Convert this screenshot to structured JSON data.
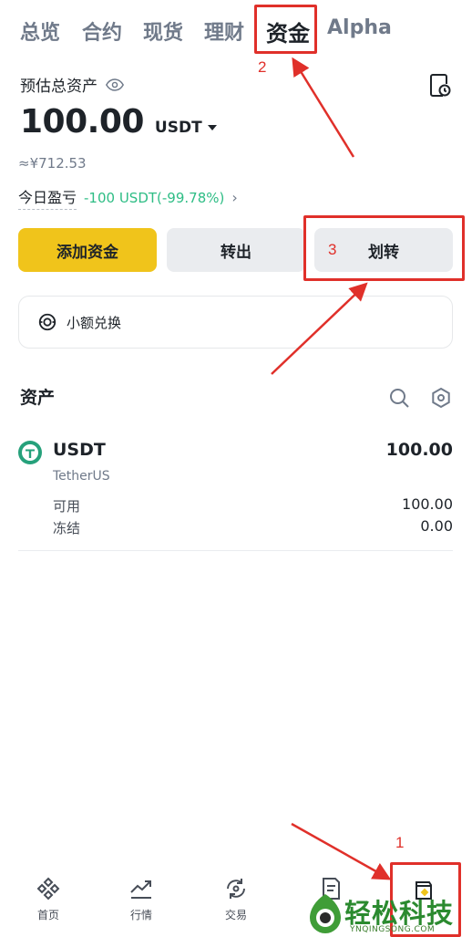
{
  "tabs": [
    {
      "label": "总览"
    },
    {
      "label": "合约"
    },
    {
      "label": "现货"
    },
    {
      "label": "理财"
    },
    {
      "label": "资金",
      "active": true
    },
    {
      "label": "Alpha"
    }
  ],
  "overview": {
    "title": "预估总资产",
    "balance": "100.00",
    "currency": "USDT",
    "approx": "≈¥712.53",
    "pnl_label": "今日盈亏",
    "pnl_value": "-100 USDT(-99.78%)"
  },
  "actions": {
    "add_funds": "添加资金",
    "transfer_out": "转出",
    "transfer": "划转"
  },
  "small_convert": {
    "label": "小额兑换"
  },
  "assets": {
    "header": "资产",
    "items": [
      {
        "symbol": "USDT",
        "name": "TetherUS",
        "total": "100.00",
        "available_label": "可用",
        "available": "100.00",
        "frozen_label": "冻结",
        "frozen": "0.00"
      }
    ]
  },
  "bottom_nav": [
    {
      "label": "首页",
      "icon": "binance-logo-icon"
    },
    {
      "label": "行情",
      "icon": "trend-chart-icon"
    },
    {
      "label": "交易",
      "icon": "exchange-icon"
    },
    {
      "label": "",
      "icon": "document-icon"
    },
    {
      "label": "",
      "icon": "wallet-icon"
    }
  ],
  "annotations": {
    "n1": "1",
    "n2": "2",
    "n3": "3"
  },
  "watermark": {
    "title": "轻松科技",
    "sub": "YNQINGSONG.COM"
  },
  "colors": {
    "accent_yellow": "#f0c41b",
    "pnl_green": "#2ebd85",
    "annotation_red": "#e0302a",
    "watermark_green": "#2b8a2f"
  }
}
